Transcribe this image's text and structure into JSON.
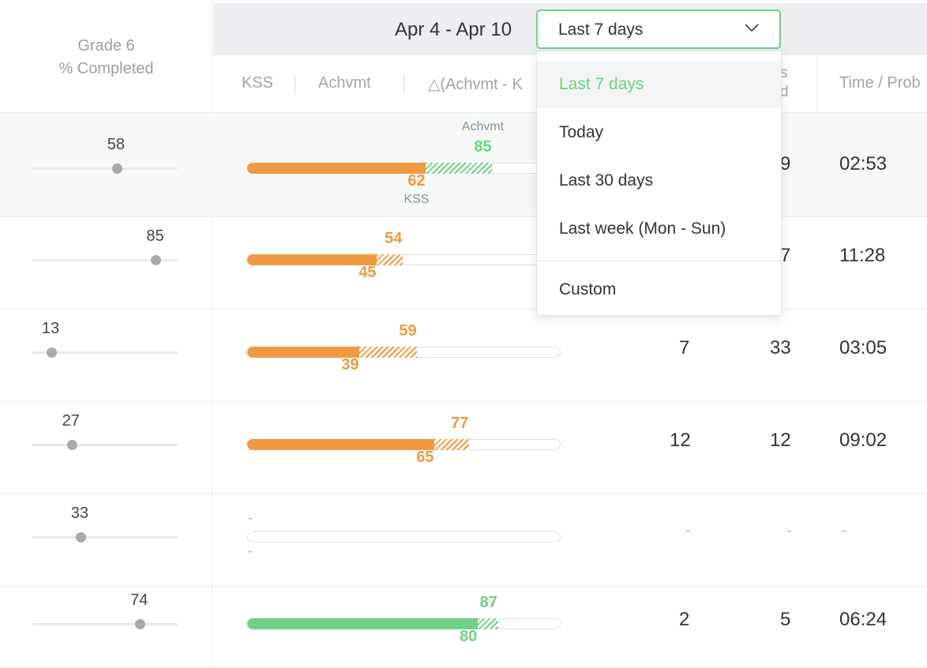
{
  "header": {
    "grade_title": "Grade 6",
    "grade_subtitle": "% Completed",
    "date_range": "Apr 4 - Apr 10"
  },
  "columns": {
    "kss": "KSS",
    "achvmt": "Achvmt",
    "delta": "△(Achvmt - K",
    "partial_label_top": "s",
    "partial_label_bottom": "d",
    "time_per_problem": "Time / Prob"
  },
  "dropdown": {
    "selected": "Last 7 days",
    "options": [
      "Last 7 days",
      "Today",
      "Last 30 days",
      "Last week (Mon - Sun)",
      "Custom"
    ]
  },
  "colors": {
    "orange": "#ef9a43",
    "green": "#6fd184",
    "header_bg": "#edeef1"
  },
  "rows": [
    {
      "completed": "58",
      "completed_pct": 58,
      "kss": "62",
      "kss_pct": 62,
      "achvmt": "85",
      "achvmt_pct": 85,
      "color": "green",
      "tag_top": "Achvmt",
      "tag_bottom": "KSS",
      "col_a": "",
      "col_b": "9",
      "time": "02:53"
    },
    {
      "completed": "85",
      "completed_pct": 85,
      "kss": "45",
      "kss_pct": 45,
      "achvmt": "54",
      "achvmt_pct": 54,
      "color": "orange",
      "col_a": "",
      "col_b": "7",
      "time": "11:28"
    },
    {
      "completed": "13",
      "completed_pct": 13,
      "kss": "39",
      "kss_pct": 39,
      "achvmt": "59",
      "achvmt_pct": 59,
      "color": "orange",
      "col_a": "7",
      "col_b": "33",
      "time": "03:05"
    },
    {
      "completed": "27",
      "completed_pct": 27,
      "kss": "65",
      "kss_pct": 65,
      "achvmt": "77",
      "achvmt_pct": 77,
      "color": "orange",
      "col_a": "12",
      "col_b": "12",
      "time": "09:02"
    },
    {
      "completed": "33",
      "completed_pct": 33,
      "kss": "-",
      "achvmt": "-",
      "color": "none",
      "col_a": "-",
      "col_b": "-",
      "time": "-"
    },
    {
      "completed": "74",
      "completed_pct": 74,
      "kss": "80",
      "kss_pct": 80,
      "achvmt": "87",
      "achvmt_pct": 87,
      "color": "green",
      "col_a": "2",
      "col_b": "5",
      "time": "06:24"
    }
  ]
}
